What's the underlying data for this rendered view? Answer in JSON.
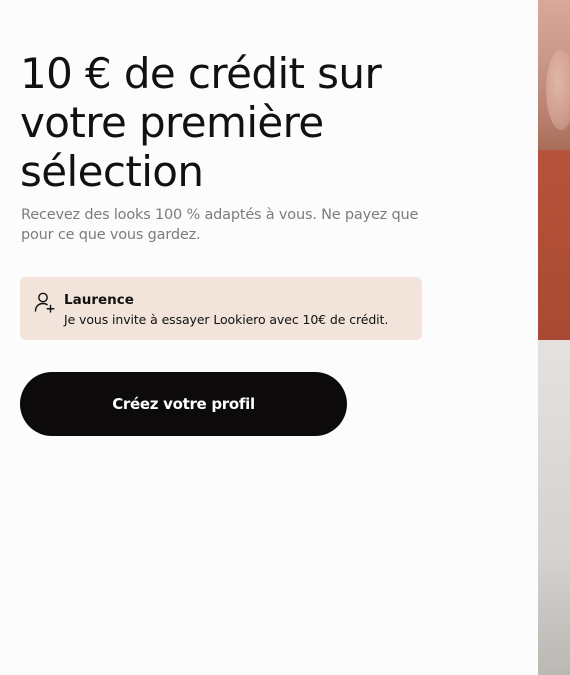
{
  "hero": {
    "title": "10 € de crédit sur votre première sélection",
    "subtitle": "Recevez des looks 100 % adaptés à vous. Ne payez que pour ce que vous gardez."
  },
  "invite": {
    "icon": "user-plus-icon",
    "name": "Laurence",
    "message": "Je vous invite à essayer Lookiero avec 10€ de crédit."
  },
  "cta": {
    "label": "Créez votre profil"
  },
  "colors": {
    "card_background": "#f2e4db",
    "button_background": "#0c0a0a",
    "button_text": "#ffffff",
    "subtitle_text": "#7c7c7c"
  }
}
